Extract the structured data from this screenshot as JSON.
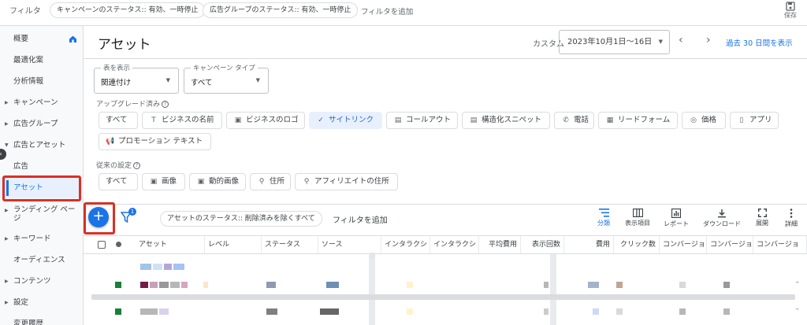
{
  "filterbar": {
    "label": "フィルタ",
    "chips": [
      "キャンペーンのステータス:: 有効、一時停止",
      "広告グループのステータス:: 有効、一時停止"
    ],
    "add": "フィルタを追加",
    "save": "保存"
  },
  "sidebar": {
    "items": [
      {
        "label": "概要"
      },
      {
        "label": "最適化案"
      },
      {
        "label": "分析情報"
      },
      {
        "label": "キャンペーン"
      },
      {
        "label": "広告グループ"
      },
      {
        "label": "広告とアセット"
      },
      {
        "label": "広告"
      },
      {
        "label": "アセット"
      },
      {
        "label": "ランディング ページ"
      },
      {
        "label": "キーワード"
      },
      {
        "label": "オーディエンス"
      },
      {
        "label": "コンテンツ"
      },
      {
        "label": "設定"
      },
      {
        "label": "変更履歴"
      }
    ]
  },
  "header": {
    "title": "アセット",
    "custom": "カスタム",
    "date_range": "2023年10月1日〜16日",
    "prev": "‹",
    "next": "›",
    "past_30": "過去 30 日間を表示"
  },
  "controls": {
    "view_label": "表を表示",
    "view_value": "関連付け",
    "campaign_type_label": "キャンペーン タイプ",
    "campaign_type_value": "すべて",
    "upgraded_label": "アップグレード済み",
    "upgraded_chips": [
      "すべて",
      "ビジネスの名前",
      "ビジネスのロゴ",
      "サイトリンク",
      "コールアウト",
      "構造化スニペット",
      "電話",
      "リードフォーム",
      "価格",
      "アプリ",
      "プロモーション テキスト"
    ],
    "legacy_label": "従来の設定",
    "legacy_chips": [
      "すべて",
      "画像",
      "動的画像",
      "住所",
      "アフィリエイトの住所"
    ]
  },
  "toolbar": {
    "filter_badge": "1",
    "status_chip": "アセットのステータス:: 削除済みを除くすべて",
    "add_filter": "フィルタを追加",
    "tools": [
      "分類",
      "表示項目",
      "レポート",
      "ダウンロード",
      "展開",
      "詳細"
    ]
  },
  "table": {
    "columns": [
      "アセット",
      "レベル",
      "ステータス",
      "ソース",
      "インタラクシ",
      "インタラクシ",
      "平均費用",
      "表示回数",
      "費用",
      "クリック数",
      "コンバージョ",
      "コンバージョ",
      "コンバージョ"
    ],
    "dash": "–"
  },
  "colors": {
    "accent": "#1a73e8",
    "highlight": "#d93025"
  }
}
